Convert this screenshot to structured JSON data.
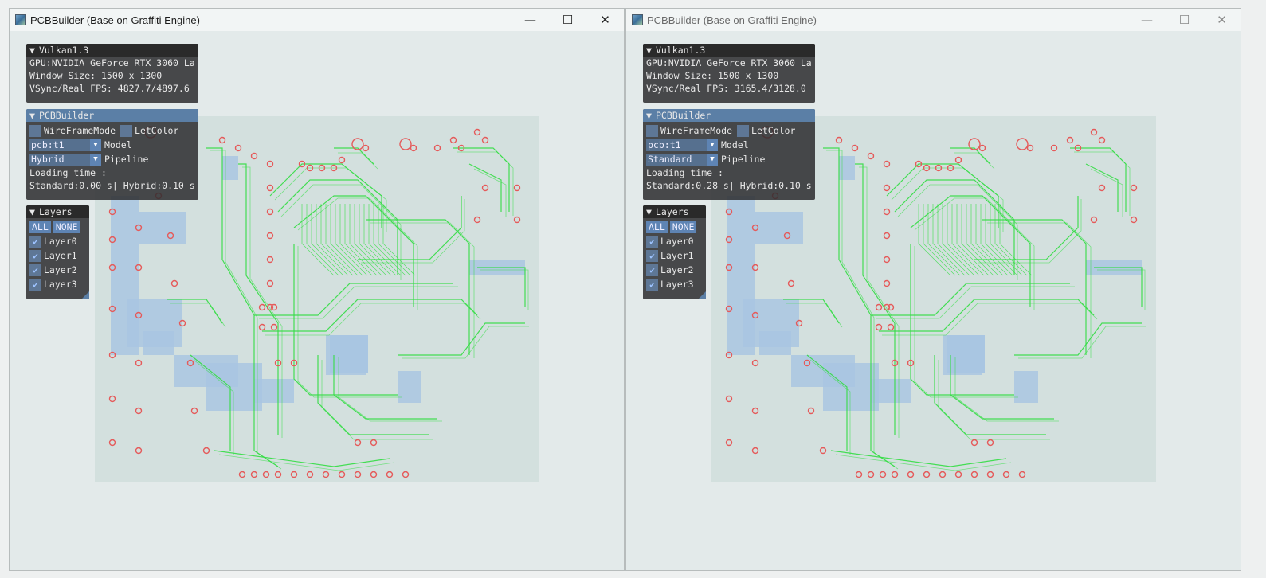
{
  "windows": [
    {
      "title": "PCBBuilder (Base on Graffiti Engine)",
      "caption": {
        "minimize": "—",
        "maximize": "☐",
        "close": "✕"
      },
      "vulkan": {
        "title": "Vulkan1.3",
        "gpu": "GPU:NVIDIA GeForce RTX 3060 La",
        "window_size": "Window Size: 1500 x 1300",
        "fps": "VSync/Real FPS: 4827.7/4897.6"
      },
      "pcbbuilder": {
        "title": "PCBBuilder",
        "wireframe_label": "WireFrameMode",
        "letcolor_label": "LetColor",
        "model_value": "pcb:t1",
        "model_label": "Model",
        "pipeline_value": "Hybrid",
        "pipeline_label": "Pipeline",
        "loading_label": "Loading time :",
        "loading_value": "Standard:0.00 s| Hybrid:0.10 s"
      },
      "layers": {
        "title": "Layers",
        "all_label": "ALL",
        "none_label": "NONE",
        "items": [
          "Layer0",
          "Layer1",
          "Layer2",
          "Layer3"
        ],
        "checked": [
          true,
          true,
          true,
          true
        ]
      }
    },
    {
      "title": "PCBBuilder (Base on Graffiti Engine)",
      "caption": {
        "minimize": "—",
        "maximize": "☐",
        "close": "✕"
      },
      "vulkan": {
        "title": "Vulkan1.3",
        "gpu": "GPU:NVIDIA GeForce RTX 3060 La",
        "window_size": "Window Size: 1500 x 1300",
        "fps": "VSync/Real FPS: 3165.4/3128.0"
      },
      "pcbbuilder": {
        "title": "PCBBuilder",
        "wireframe_label": "WireFrameMode",
        "letcolor_label": "LetColor",
        "model_value": "pcb:t1",
        "model_label": "Model",
        "pipeline_value": "Standard",
        "pipeline_label": "Pipeline",
        "loading_label": "Loading time :",
        "loading_value": "Standard:0.28 s| Hybrid:0.10 s"
      },
      "layers": {
        "title": "Layers",
        "all_label": "ALL",
        "none_label": "NONE",
        "items": [
          "Layer0",
          "Layer1",
          "Layer2",
          "Layer3"
        ],
        "checked": [
          true,
          true,
          true,
          true
        ]
      }
    }
  ],
  "colors": {
    "trace": "#33dd44",
    "pad_ring": "#e55a5a",
    "copper_pour": "#a9c6e2",
    "board": "#d3e0de"
  },
  "icons": {
    "collapse": "triangle-down-icon",
    "check": "checkmark-icon",
    "combo_arrow": "triangle-down-icon"
  }
}
